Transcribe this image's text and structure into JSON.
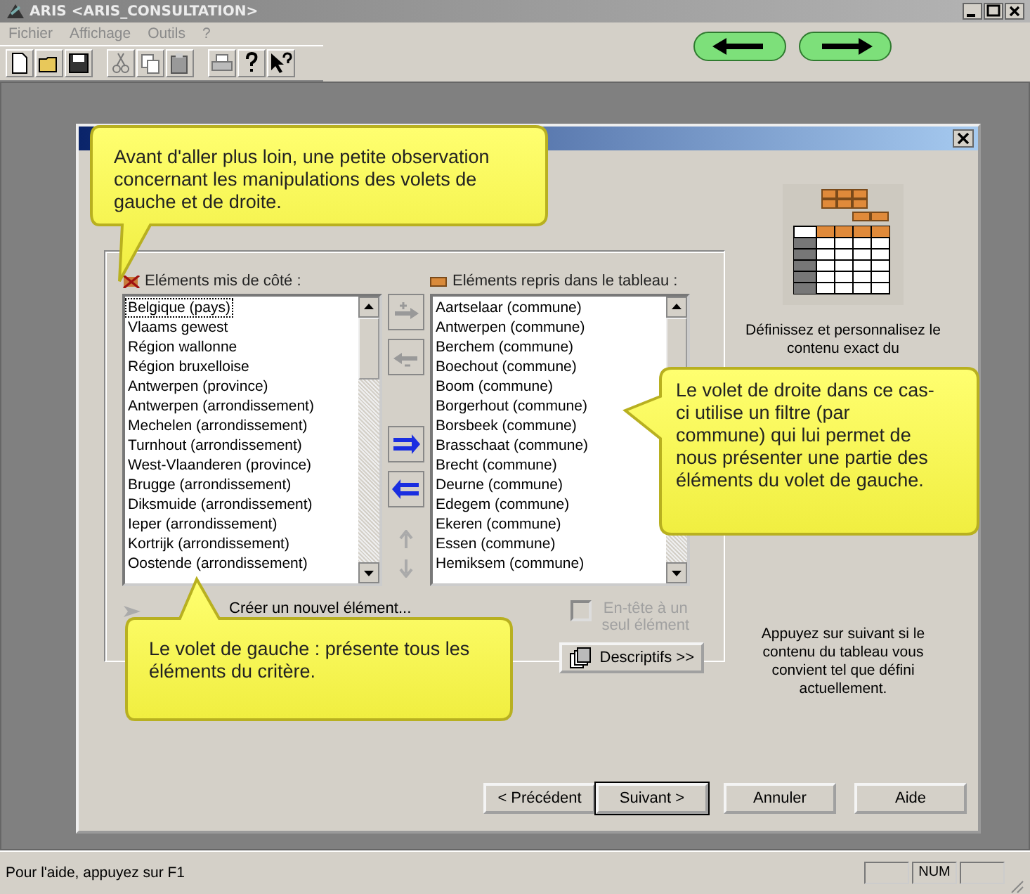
{
  "window": {
    "title": "ARIS <ARIS_CONSULTATION>"
  },
  "menu": [
    "Fichier",
    "Affichage",
    "Outils",
    "?"
  ],
  "dialog": {
    "left_pane": {
      "label": "Eléments mis de côté :",
      "items": [
        {
          "text": "Belgique (pays)",
          "selected": false,
          "focused": true
        },
        {
          "text": "Vlaams gewest",
          "selected": false,
          "focused": false
        },
        {
          "text": "Région wallonne",
          "selected": false,
          "focused": false
        },
        {
          "text": "Région bruxelloise",
          "selected": false,
          "focused": false
        },
        {
          "text": "Antwerpen (province)",
          "selected": false,
          "focused": false
        },
        {
          "text": "Antwerpen (arrondissement)",
          "selected": false,
          "focused": false
        },
        {
          "text": "Mechelen (arrondissement)",
          "selected": false,
          "focused": false
        },
        {
          "text": "Turnhout (arrondissement)",
          "selected": false,
          "focused": false
        },
        {
          "text": "West-Vlaanderen (province)",
          "selected": false,
          "focused": false
        },
        {
          "text": "Brugge (arrondissement)",
          "selected": false,
          "focused": false
        },
        {
          "text": "Diksmuide (arrondissement)",
          "selected": false,
          "focused": false
        },
        {
          "text": "Ieper (arrondissement)",
          "selected": false,
          "focused": false
        },
        {
          "text": "Kortrijk (arrondissement)",
          "selected": false,
          "focused": false
        },
        {
          "text": "Oostende (arrondissement)",
          "selected": false,
          "focused": false
        }
      ]
    },
    "right_pane": {
      "label": "Eléments repris dans le tableau :",
      "items": [
        {
          "text": "Aartselaar (commune)",
          "selected": false,
          "focused": false
        },
        {
          "text": "Antwerpen (commune)",
          "selected": false,
          "focused": false
        },
        {
          "text": "Berchem (commune)",
          "selected": false,
          "focused": false
        },
        {
          "text": "Boechout (commune)",
          "selected": false,
          "focused": false
        },
        {
          "text": "Boom (commune)",
          "selected": false,
          "focused": false
        },
        {
          "text": "Borgerhout (commune)",
          "selected": false,
          "focused": false
        },
        {
          "text": "Borsbeek (commune)",
          "selected": false,
          "focused": false
        },
        {
          "text": "Brasschaat (commune)",
          "selected": false,
          "focused": false
        },
        {
          "text": "Brecht (commune)",
          "selected": false,
          "focused": false
        },
        {
          "text": "Deurne (commune)",
          "selected": false,
          "focused": false
        },
        {
          "text": "Edegem (commune)",
          "selected": false,
          "focused": false
        },
        {
          "text": "Ekeren (commune)",
          "selected": false,
          "focused": false
        },
        {
          "text": "Essen (commune)",
          "selected": false,
          "focused": false
        },
        {
          "text": "Hemiksem (commune)",
          "selected": false,
          "focused": false
        }
      ]
    },
    "create_label": "Créer un nouvel élément...",
    "header_checkbox": {
      "label": "En-tête à un seul élément",
      "checked": false,
      "disabled": true
    },
    "descriptions_button": "Descriptifs >>",
    "side_description": "Définissez et personnalisez le contenu exact du",
    "side_hint": "Appuyez sur suivant si le contenu du tableau vous convient tel que défini actuellement.",
    "buttons": [
      {
        "label": "< Précédent",
        "default": false
      },
      {
        "label": "Suivant >",
        "default": true
      },
      {
        "label": "Annuler",
        "default": false
      },
      {
        "label": "Aide",
        "default": false
      }
    ]
  },
  "callouts": [
    "Avant d'aller plus loin, une petite observation concernant les manipulations des volets de gauche et de droite.",
    "Le volet de droite dans ce cas-ci  utilise un filtre (par commune) qui lui permet de nous présenter une partie des éléments du volet de gauche.",
    "Le volet de gauche : présente tous les éléments du critère."
  ],
  "status_bar": {
    "text": "Pour l'aide, appuyez sur F1",
    "indicators": [
      "NUM"
    ]
  }
}
